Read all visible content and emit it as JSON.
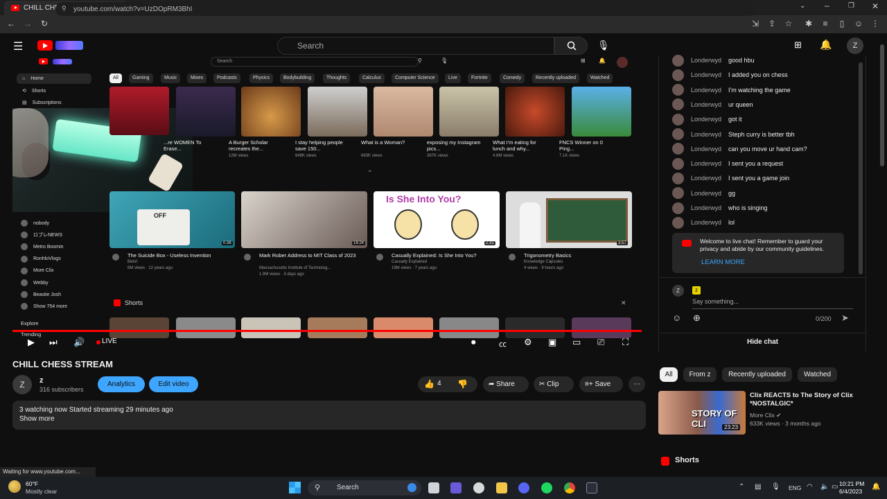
{
  "browser": {
    "tab_title": "CHILL CHESS STREAM - YouTube",
    "url": "youtube.com/watch?v=UzDOpRM3BhI",
    "status_text": "Waiting for www.youtube.com..."
  },
  "header": {
    "search_placeholder": "Search",
    "avatar_letter": "Z"
  },
  "inner_stream": {
    "search_placeholder": "Search",
    "chips": [
      "All",
      "Gaming",
      "Music",
      "Mixes",
      "Podcasts",
      "Physics",
      "Bodybuilding",
      "Thoughts",
      "Calculus",
      "Computer Science",
      "Live",
      "Fortnite",
      "Comedy",
      "Recently uploaded",
      "Watched"
    ],
    "sidebar_top": [
      "Home",
      "Shorts",
      "Subscriptions"
    ],
    "sidebar_subs": [
      "nobody",
      "ロブレNEWS",
      "Metro Boomin",
      "RonhloVlogs",
      "More Clix",
      "Webby",
      "Beastie Josh",
      "Show 754 more"
    ],
    "sidebar_explore": [
      "Explore",
      "Trending"
    ],
    "row1": [
      {
        "title": "...re WOMEN To Erase...",
        "meta": ""
      },
      {
        "title": "A Burger Scholar recreates the...",
        "meta": "12M views"
      },
      {
        "title": "I stay helping people save 150...",
        "meta": "648K views"
      },
      {
        "title": "What is a Woman?",
        "meta": "663K views"
      },
      {
        "title": "exposing my Instagram pics...",
        "meta": "367K views"
      },
      {
        "title": "What I'm eating for lunch and why...",
        "meta": "4.6M views"
      },
      {
        "title": "FNCS Winner on 0 Ping...",
        "meta": "7.1K views"
      }
    ],
    "row2": [
      {
        "title": "The Suicide Box - Useless Invention",
        "channel": "Bebrl",
        "meta": "8M views · 12 years ago",
        "duration": "0:38"
      },
      {
        "title": "Mark Rober Address to MIT Class of 2023",
        "channel": "Massachusetts Institute of Technolog...",
        "meta": "1.9M views · 3 days ago",
        "duration": "19:24"
      },
      {
        "title": "Casually Explained: Is She Into You?",
        "channel": "Casually Explained",
        "meta": "19M views · 7 years ago",
        "duration": "2:31"
      },
      {
        "title": "Trigonometry Basics",
        "channel": "Knowledge Capsules",
        "meta": "4 views · 9 hours ago",
        "duration": "3:57"
      }
    ],
    "thumb_text": "Is She Into You?",
    "shorts_label": "Shorts"
  },
  "player": {
    "live_label": "LIVE"
  },
  "video": {
    "title": "CHILL CHESS STREAM",
    "channel": "z",
    "subscribers": "316 subscribers",
    "analytics_label": "Analytics",
    "edit_label": "Edit video",
    "likes": "4",
    "share_label": "Share",
    "clip_label": "Clip",
    "save_label": "Save",
    "description": "3 watching now  Started streaming 29 minutes ago",
    "show_more": "Show more"
  },
  "chat": {
    "messages": [
      {
        "author": "Londerwyd",
        "text": "good hbu"
      },
      {
        "author": "Londerwyd",
        "text": "I added you on chess"
      },
      {
        "author": "Londerwyd",
        "text": "I'm watching the game"
      },
      {
        "author": "Londerwyd",
        "text": "ur queen"
      },
      {
        "author": "Londerwyd",
        "text": "got it"
      },
      {
        "author": "Londerwyd",
        "text": "Steph curry is better tbh"
      },
      {
        "author": "Londerwyd",
        "text": "can you move ur hand cam?"
      },
      {
        "author": "Londerwyd",
        "text": "I sent you a request"
      },
      {
        "author": "Londerwyd",
        "text": "I sent you a game join"
      },
      {
        "author": "Londerwyd",
        "text": "gg"
      },
      {
        "author": "Londerwyd",
        "text": "who is singing"
      },
      {
        "author": "Londerwyd",
        "text": "lol"
      }
    ],
    "notice": "Welcome to live chat! Remember to guard your privacy and abide by our community guidelines.",
    "learn_more": "LEARN MORE",
    "input_user": "z",
    "input_placeholder": "Say something...",
    "char_count": "0/200",
    "hide_chat": "Hide chat"
  },
  "filters": [
    "All",
    "From z",
    "Recently uploaded",
    "Watched"
  ],
  "recommended": {
    "title": "Clix REACTS to The Story of Clix *NOSTALGIC*",
    "channel": "More Clix",
    "meta": "633K views · 3 months ago",
    "duration": "23:23",
    "thumb_text": "STORY OF CLI"
  },
  "shorts_section": "Shorts",
  "taskbar": {
    "temp": "60°F",
    "weather": "Mostly clear",
    "search_label": "Search",
    "lang": "ENG",
    "time": "10:21 PM",
    "date": "6/4/2023"
  },
  "colors": {
    "accent_blue": "#3ea6ff",
    "youtube_red": "#ff0000"
  }
}
